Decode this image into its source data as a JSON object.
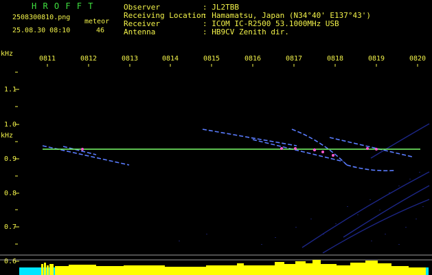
{
  "header": {
    "title": "H R O F F T",
    "filename": "2508300810.png",
    "datetime": "25.08.30 08:10",
    "meteor_label": "meteor",
    "meteor_count": "46"
  },
  "info": {
    "rows": [
      {
        "label": "Observer",
        "value": ": JL2TBB"
      },
      {
        "label": "Receiving Location",
        "value": ": Hamamatsu, Japan (N34°40' E137°43')"
      },
      {
        "label": "Receiver",
        "value": ": ICOM IC-R2500 53.1000MHz USB"
      },
      {
        "label": "Antenna",
        "value": ": HB9CV Zenith dir."
      }
    ]
  },
  "axis": {
    "unit": "kHz",
    "time_ticks": [
      "0811",
      "0812",
      "0813",
      "0814",
      "0815",
      "0816",
      "0817",
      "0818",
      "0819",
      "0820"
    ],
    "freq_labels": [
      "1.1",
      "1.0",
      "0.9",
      "0.8",
      "0.7",
      "0.6"
    ]
  },
  "colors": {
    "text": "#f3f34a",
    "title": "#3fe03f",
    "reference_line": "#7cff6b",
    "trace": "#5a7cff",
    "meteor_head": "#ff5ad1",
    "level_bar": "#ffff00",
    "noise_floor": "#00e5ff"
  }
}
